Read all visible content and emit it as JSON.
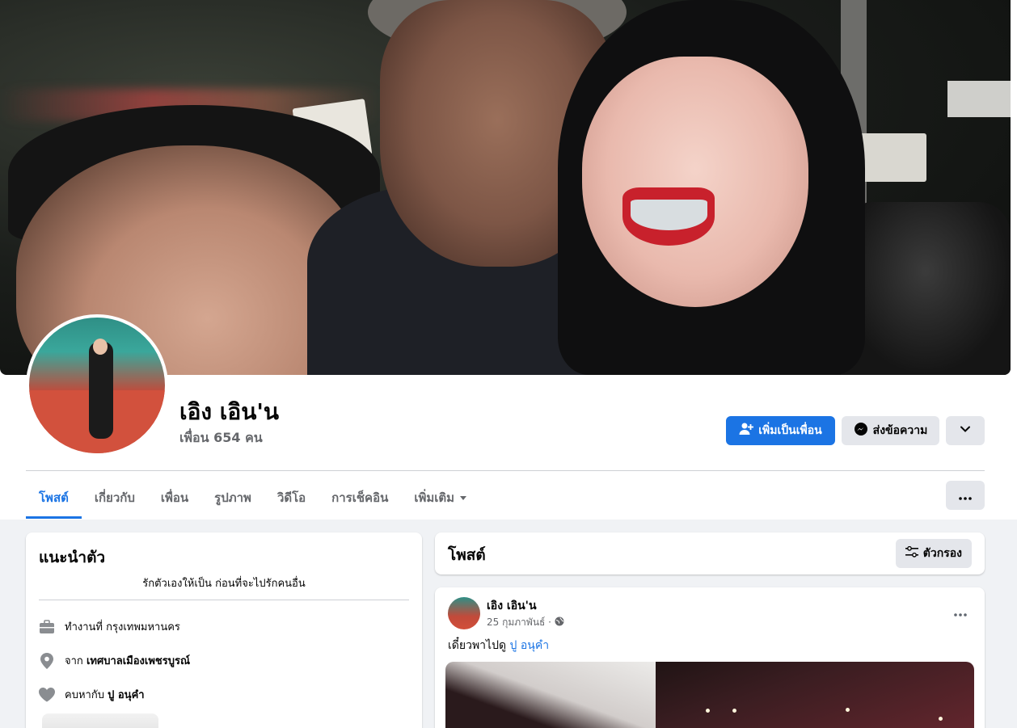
{
  "profile": {
    "name": "เอิง เอิน'น",
    "friends": "เพื่อน 654 คน"
  },
  "actions": {
    "add_friend": "เพิ่มเป็นเพื่อน",
    "message": "ส่งข้อความ"
  },
  "tabs": [
    {
      "label": "โพสต์",
      "active": true
    },
    {
      "label": "เกี่ยวกับ",
      "active": false
    },
    {
      "label": "เพื่อน",
      "active": false
    },
    {
      "label": "รูปภาพ",
      "active": false
    },
    {
      "label": "วิดีโอ",
      "active": false
    },
    {
      "label": "การเช็คอิน",
      "active": false
    },
    {
      "label": "เพิ่มเติม",
      "active": false
    }
  ],
  "intro": {
    "title": "แนะนำตัว",
    "bio": "รักตัวเองให้เป็น ก่อนที่จะไปรักคนอื่น",
    "work": {
      "prefix": "ทำงานที่",
      "value": "กรุงเทพมหานคร"
    },
    "from": {
      "prefix": "จาก",
      "value": "เทศบาลเมืองเพชรบูรณ์"
    },
    "relationship": {
      "prefix": "คบหากับ",
      "value": "ปู อนุคํา"
    }
  },
  "posts_header": {
    "title": "โพสต์",
    "filter_label": "ตัวกรอง"
  },
  "post": {
    "author": "เอิง เอิน'น",
    "date": "25 กุมภาพันธ์ ·",
    "text": "เดี๋ยวพาไปดู",
    "tagged": "ปู อนุคํา"
  },
  "colors": {
    "accent": "#1b74e4",
    "background": "#f0f2f5",
    "secondary_button": "#e4e6eb",
    "muted_text": "#65676b"
  },
  "icons": {
    "add_friend": "person-add-icon",
    "message": "messenger-icon",
    "dropdown": "chevron-down-icon",
    "more": "more-dots-icon",
    "work": "briefcase-icon",
    "from": "location-pin-icon",
    "relationship": "heart-icon",
    "filter": "filter-sliders-icon",
    "audience": "globe-icon"
  }
}
